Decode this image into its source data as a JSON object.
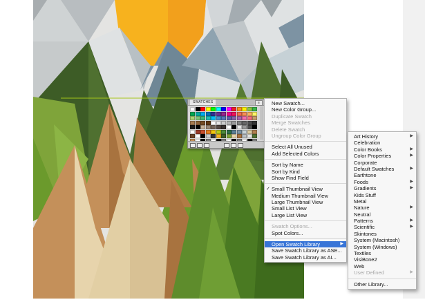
{
  "colors": {
    "menu_highlight": "#3875d7",
    "menu_bg": "#f7f7f7",
    "canvas_bg": "#ffffff"
  },
  "panel": {
    "title": "SWATCHES",
    "flyout_button": "≡",
    "bottom_icons": [
      "swatch-libraries-icon",
      "show-kinds-icon",
      "swatch-options-icon",
      "new-color-group-icon",
      "new-swatch-icon",
      "trash-icon"
    ]
  },
  "swatches": {
    "colors": [
      "#ffffff",
      "#000000",
      "#ff0000",
      "#ffff00",
      "#00ff00",
      "#00ffff",
      "#0000ff",
      "#ff00ff",
      "#ed1c24",
      "#f7941d",
      "#fff200",
      "#8dc63f",
      "#39b54a",
      "#00a651",
      "#00a99d",
      "#00aeef",
      "#0072bc",
      "#2e3192",
      "#662d91",
      "#92278f",
      "#ec008c",
      "#ed145b",
      "#f26c4f",
      "#f68e56",
      "#fbaf5d",
      "#fff568",
      "#acd373",
      "#7cc576",
      "#3cb878",
      "#1cbbb4",
      "#00bff3",
      "#448ccb",
      "#5674b9",
      "#605ca8",
      "#855fa8",
      "#a864a8",
      "#f06eaa",
      "#f26d7d",
      "#c69c6d",
      "#a67c52",
      "#8c6239",
      "#754c24",
      "#603913",
      "#ffffff",
      "#e6e6e6",
      "#cccccc",
      "#b3b3b3",
      "#999999",
      "#808080",
      "#666666",
      "#4d4d4d",
      "#333333",
      "#1a1a1a",
      "#000000",
      "#c7b299",
      "#998675",
      "#736357",
      "#534741",
      "#362f2d",
      "#ffffff",
      "#000000",
      "#e6e6e6",
      "#999999",
      "#4d4d4d",
      "#000000",
      "#ffffff",
      "#9a3b2a",
      "#c7502f",
      "#e67e22",
      "#f1c40f",
      "#b5cc18",
      "#4e8a3a",
      "#2c6e49",
      "#5b7f95",
      "#7d93a3",
      "#c6d1d6",
      "#d9c9a0",
      "#b08050",
      "#6b4226",
      "#ffffff",
      "#000000",
      "#cccccc",
      "#333333",
      "#f7b21e",
      "#3d5c26",
      "#7fa43a",
      "#e7d4ac",
      "#a8733f",
      "#b8bdc0",
      "#e4e4e2",
      "#4f7030",
      "#c4905a",
      "#ffffff",
      "#000000",
      "#808080",
      "#ffffff",
      "#000000",
      "#808080",
      "#ffffff",
      "#000000",
      "#808080",
      "#ffffff",
      "#000000",
      "#808080",
      "#ffffff"
    ]
  },
  "flyout": {
    "items": [
      {
        "label": "New Swatch..."
      },
      {
        "label": "New Color Group..."
      },
      {
        "label": "Duplicate Swatch",
        "disabled": true
      },
      {
        "label": "Merge Swatches",
        "disabled": true
      },
      {
        "label": "Delete Swatch",
        "disabled": true
      },
      {
        "label": "Ungroup Color Group",
        "disabled": true
      },
      {
        "sep": true
      },
      {
        "label": "Select All Unused"
      },
      {
        "label": "Add Selected Colors"
      },
      {
        "sep": true
      },
      {
        "label": "Sort by Name"
      },
      {
        "label": "Sort by Kind"
      },
      {
        "label": "Show Find Field"
      },
      {
        "sep": true
      },
      {
        "label": "Small Thumbnail View",
        "checked": true
      },
      {
        "label": "Medium Thumbnail View"
      },
      {
        "label": "Large Thumbnail View"
      },
      {
        "label": "Small List View"
      },
      {
        "label": "Large List View"
      },
      {
        "sep": true
      },
      {
        "label": "Swatch Options...",
        "disabled": true
      },
      {
        "label": "Spot Colors..."
      },
      {
        "sep": true
      },
      {
        "label": "Open Swatch Library",
        "submenu": true,
        "highlighted": true
      },
      {
        "label": "Save Swatch Library as ASE..."
      },
      {
        "label": "Save Swatch Library as AI..."
      }
    ]
  },
  "library": {
    "items": [
      {
        "label": "Art History",
        "submenu": true
      },
      {
        "label": "Celebration"
      },
      {
        "label": "Color Books",
        "submenu": true
      },
      {
        "label": "Color Properties",
        "submenu": true
      },
      {
        "label": "Corporate"
      },
      {
        "label": "Default Swatches",
        "submenu": true
      },
      {
        "label": "Earthtone"
      },
      {
        "label": "Foods",
        "submenu": true
      },
      {
        "label": "Gradients",
        "submenu": true
      },
      {
        "label": "Kids Stuff"
      },
      {
        "label": "Metal"
      },
      {
        "label": "Nature",
        "submenu": true
      },
      {
        "label": "Neutral"
      },
      {
        "label": "Patterns",
        "submenu": true
      },
      {
        "label": "Scientific",
        "submenu": true
      },
      {
        "label": "Skintones"
      },
      {
        "label": "System (Macintosh)"
      },
      {
        "label": "System (Windows)"
      },
      {
        "label": "Textiles"
      },
      {
        "label": "VisiBone2"
      },
      {
        "label": "Web"
      },
      {
        "label": "User Defined",
        "submenu": true,
        "disabled": true
      },
      {
        "sep": true
      },
      {
        "label": "Other Library..."
      }
    ]
  }
}
